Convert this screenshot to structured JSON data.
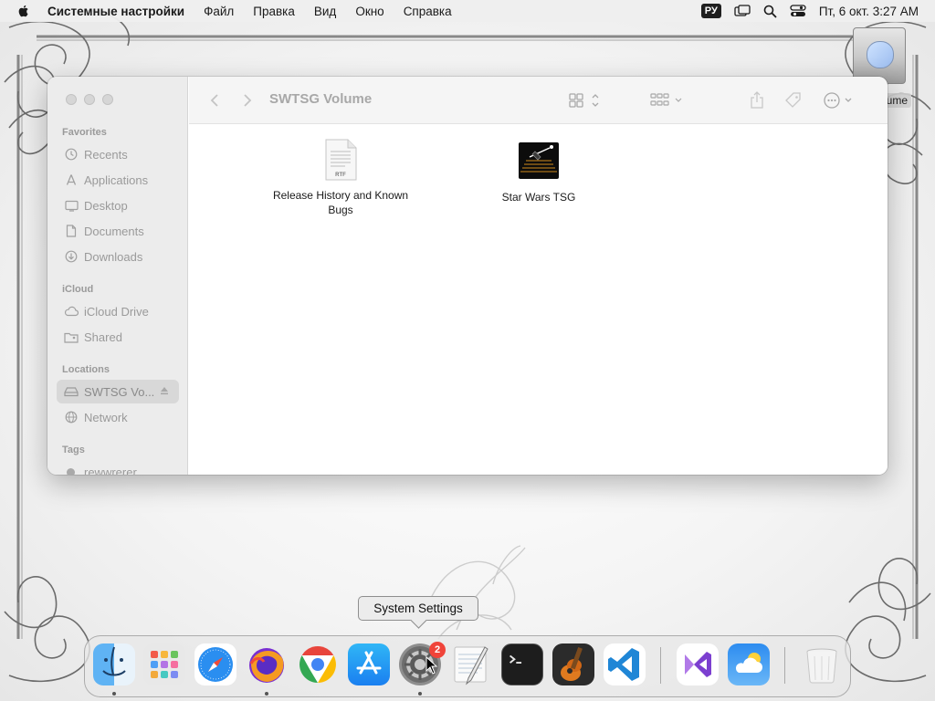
{
  "menubar": {
    "app_name": "Системные настройки",
    "menus": [
      "Файл",
      "Правка",
      "Вид",
      "Окно",
      "Справка"
    ],
    "input_source": "РУ",
    "clock": "Пт, 6 окт.  3:27 AM"
  },
  "desktop": {
    "volume_label": "olume"
  },
  "finder": {
    "title": "SWTSG Volume",
    "sidebar": {
      "favorites_heading": "Favorites",
      "favorites": [
        {
          "label": "Recents",
          "icon": "clock-icon"
        },
        {
          "label": "Applications",
          "icon": "applications-icon"
        },
        {
          "label": "Desktop",
          "icon": "desktop-icon"
        },
        {
          "label": "Documents",
          "icon": "document-icon"
        },
        {
          "label": "Downloads",
          "icon": "download-icon"
        }
      ],
      "icloud_heading": "iCloud",
      "icloud": [
        {
          "label": "iCloud Drive",
          "icon": "cloud-icon"
        },
        {
          "label": "Shared",
          "icon": "shared-folder-icon"
        }
      ],
      "locations_heading": "Locations",
      "locations": [
        {
          "label": "SWTSG Vo...",
          "icon": "drive-icon",
          "selected": true
        },
        {
          "label": "Network",
          "icon": "globe-icon"
        }
      ],
      "tags_heading": "Tags",
      "tags": [
        {
          "label": "rewwrerer"
        }
      ]
    },
    "files": [
      {
        "name": "Release History and Known Bugs",
        "icon": "rtf-document-icon",
        "thumb_label": "RTF"
      },
      {
        "name": "Star Wars TSG",
        "icon": "app-icon"
      }
    ]
  },
  "tooltip": {
    "text": "System Settings"
  },
  "dock": {
    "apps": [
      {
        "name": "Finder",
        "icon": "finder-icon",
        "running": true
      },
      {
        "name": "Launchpad",
        "icon": "launchpad-icon",
        "running": false
      },
      {
        "name": "Safari",
        "icon": "safari-icon",
        "running": false
      },
      {
        "name": "Firefox",
        "icon": "firefox-icon",
        "running": true
      },
      {
        "name": "Chrome",
        "icon": "chrome-icon",
        "running": false
      },
      {
        "name": "App Store",
        "icon": "app-store-icon",
        "running": false
      },
      {
        "name": "System Settings",
        "icon": "system-settings-icon",
        "running": true,
        "badge": "2"
      },
      {
        "name": "TextEdit",
        "icon": "textedit-icon",
        "running": false
      },
      {
        "name": "Terminal",
        "icon": "terminal-icon",
        "running": false
      },
      {
        "name": "GarageBand",
        "icon": "garageband-icon",
        "running": false
      },
      {
        "name": "Visual Studio Code",
        "icon": "vscode-icon",
        "running": false
      },
      {
        "name": "Visual Studio",
        "icon": "visual-studio-icon",
        "running": false
      },
      {
        "name": "Weather",
        "icon": "weather-icon",
        "running": false
      },
      {
        "name": "Trash",
        "icon": "trash-icon",
        "running": false
      }
    ]
  }
}
